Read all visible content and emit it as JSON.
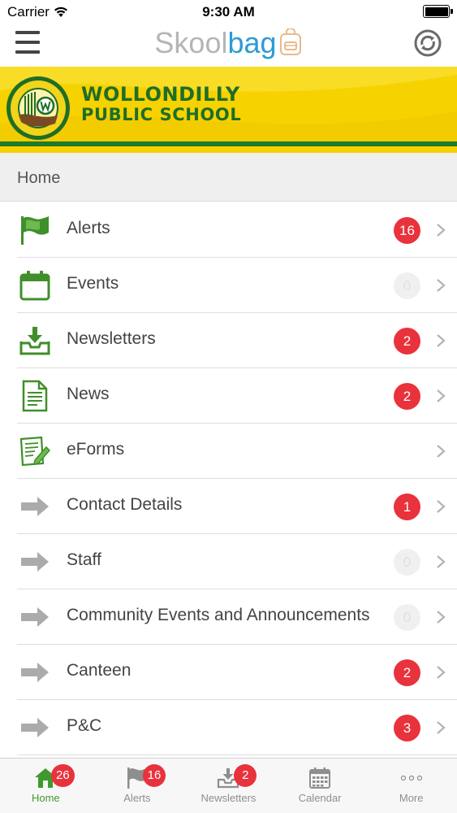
{
  "status_bar": {
    "carrier": "Carrier",
    "time": "9:30 AM"
  },
  "nav": {
    "brand_part1": "Skool",
    "brand_part2": "bag"
  },
  "banner": {
    "name_line1": "WOLLONDILLY",
    "name_line2": "PUBLIC SCHOOL"
  },
  "section": {
    "title": "Home"
  },
  "menu": [
    {
      "label": "Alerts",
      "badge": "16",
      "icon": "flag-icon"
    },
    {
      "label": "Events",
      "badge": "0",
      "icon": "calendar-icon"
    },
    {
      "label": "Newsletters",
      "badge": "2",
      "icon": "inbox-download-icon"
    },
    {
      "label": "News",
      "badge": "2",
      "icon": "document-icon"
    },
    {
      "label": "eForms",
      "badge": "",
      "icon": "form-pencil-icon"
    },
    {
      "label": "Contact Details",
      "badge": "1",
      "icon": "arrow-right-icon"
    },
    {
      "label": "Staff",
      "badge": "0",
      "icon": "arrow-right-icon"
    },
    {
      "label": "Community Events and Announcements",
      "badge": "0",
      "icon": "arrow-right-icon"
    },
    {
      "label": "Canteen",
      "badge": "2",
      "icon": "arrow-right-icon"
    },
    {
      "label": "P&C",
      "badge": "3",
      "icon": "arrow-right-icon"
    }
  ],
  "tabs": [
    {
      "label": "Home",
      "badge": "26",
      "icon": "home-icon"
    },
    {
      "label": "Alerts",
      "badge": "16",
      "icon": "flag-icon"
    },
    {
      "label": "Newsletters",
      "badge": "2",
      "icon": "inbox-download-icon"
    },
    {
      "label": "Calendar",
      "badge": "",
      "icon": "calendar-grid-icon"
    },
    {
      "label": "More",
      "badge": "",
      "icon": "more-dots-icon"
    }
  ],
  "colors": {
    "brand_green": "#3f9a2e",
    "badge_red": "#e8323c",
    "banner_yellow": "#f6d200",
    "brand_blue": "#2d9bd5"
  }
}
